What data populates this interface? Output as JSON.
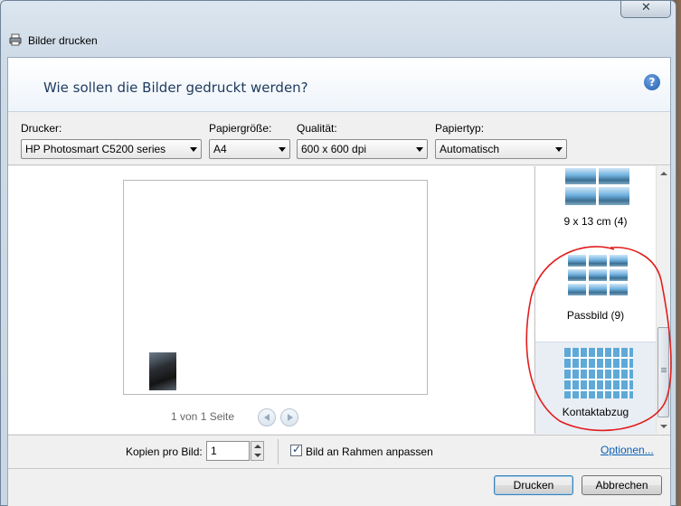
{
  "window": {
    "title": "Bilder drucken",
    "close_glyph": "✕"
  },
  "header": {
    "title": "Wie sollen die Bilder gedruckt werden?"
  },
  "settings": {
    "printer": {
      "label": "Drucker:",
      "value": "HP Photosmart C5200 series"
    },
    "paper_size": {
      "label": "Papiergröße:",
      "value": "A4"
    },
    "quality": {
      "label": "Qualität:",
      "value": "600 x 600 dpi"
    },
    "paper_type": {
      "label": "Papiertyp:",
      "value": "Automatisch"
    },
    "help_glyph": "?"
  },
  "preview": {
    "page_info": "1 von 1 Seite"
  },
  "layouts": {
    "items": [
      {
        "label": "9 x 13 cm (4)",
        "selected": false
      },
      {
        "label": "Passbild (9)",
        "selected": false
      },
      {
        "label": "Kontaktabzug",
        "selected": true
      }
    ]
  },
  "options": {
    "copies_label": "Kopien pro Bild:",
    "copies_value": "1",
    "fit_label": "Bild an Rahmen anpassen",
    "fit_checked": true,
    "check_glyph": "✓",
    "options_link": "Optionen..."
  },
  "buttons": {
    "print": "Drucken",
    "cancel": "Abbrechen"
  },
  "colors": {
    "header_text": "#1e3a5f",
    "link": "#0a5fb4",
    "annotation": "#e11d1d"
  }
}
